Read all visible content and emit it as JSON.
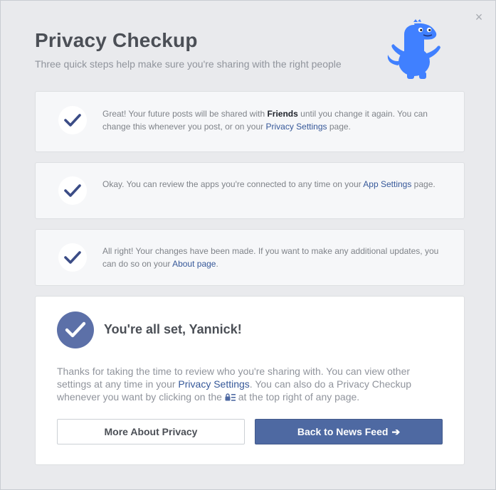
{
  "dialog": {
    "title": "Privacy Checkup",
    "subtitle": "Three quick steps help make sure you're sharing with the right people",
    "close_icon": "×"
  },
  "steps": [
    {
      "text_1": "Great! Your future posts will be shared with ",
      "bold": "Friends",
      "text_2": " until you change it again. You can change this whenever you post, or on your ",
      "link": "Privacy Settings",
      "text_3": " page."
    },
    {
      "text_1": "Okay. You can review the apps you're connected to any time on your ",
      "link": "App Settings",
      "text_2": " page."
    },
    {
      "text_1": "All right! Your changes have been made. If you want to make any additional updates, you can do so on your ",
      "link": "About page",
      "text_2": "."
    }
  ],
  "final": {
    "heading": "You're all set, Yannick!",
    "body_1": "Thanks for taking the time to review who you're sharing with. You can view other settings at any time in your ",
    "body_link": "Privacy Settings",
    "body_2": ". You can also do a Privacy Checkup whenever you want by clicking on the ",
    "body_3": " at the top right of any page.",
    "more_button": "More About Privacy",
    "feed_button": "Back to News Feed",
    "feed_arrow": "➔"
  },
  "colors": {
    "accent": "#4e69a2",
    "link": "#365899",
    "check": "#3b4c86",
    "mascot": "#4080ff"
  },
  "icons": {
    "close": "close-icon",
    "check": "check-icon",
    "lock": "lock-menu-icon",
    "mascot": "privacy-dinosaur-icon"
  }
}
